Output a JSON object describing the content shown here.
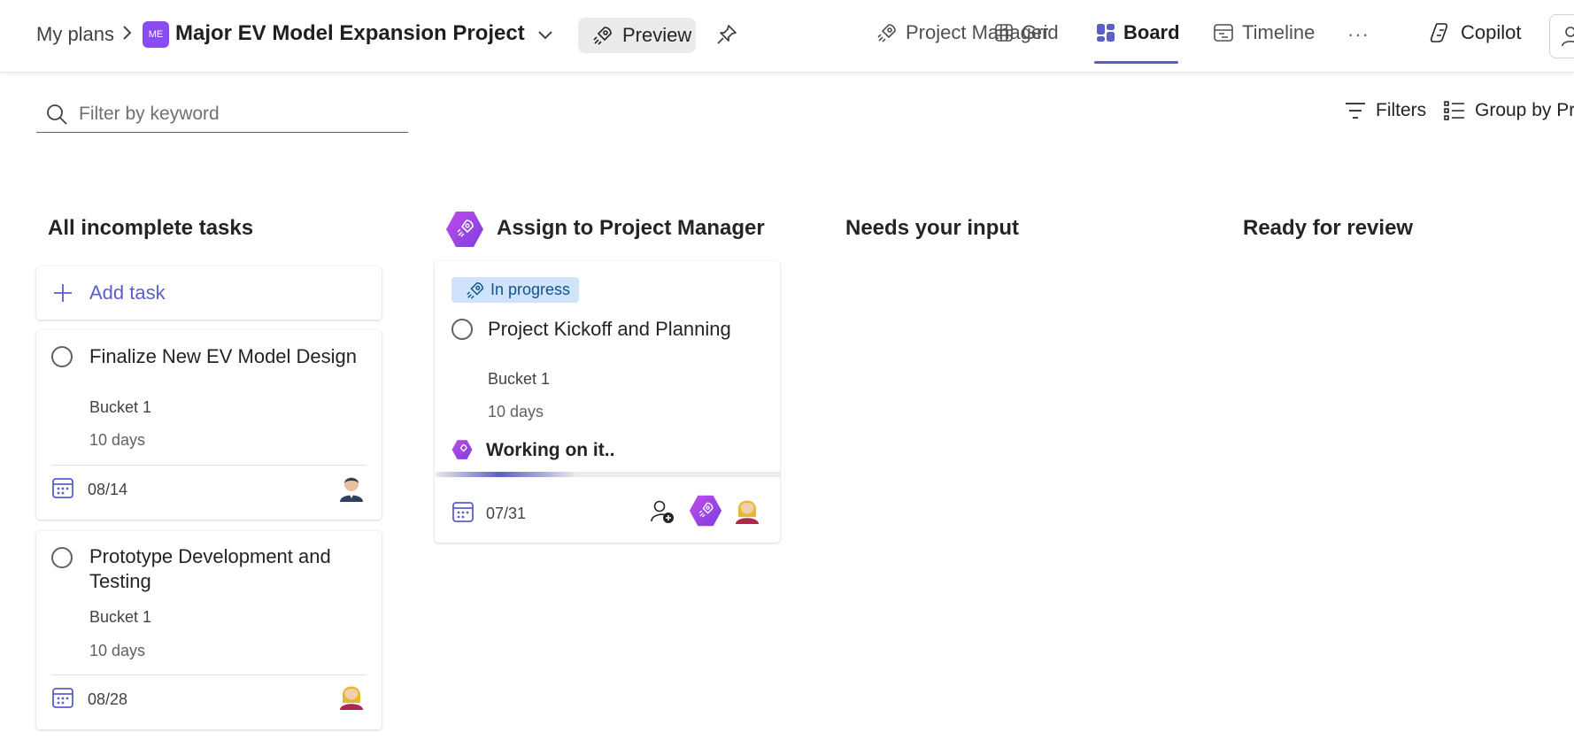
{
  "breadcrumb": {
    "root": "My plans"
  },
  "plan": {
    "badge": "ME",
    "title": "Major EV Model Expansion Project"
  },
  "preview": {
    "label": "Preview"
  },
  "tabs": [
    {
      "label": "Project Manager",
      "icon": "rocket-icon"
    },
    {
      "label": "Grid",
      "icon": "grid-icon"
    },
    {
      "label": "Board",
      "icon": "board-icon",
      "active": true
    },
    {
      "label": "Timeline",
      "icon": "timeline-icon"
    }
  ],
  "more": {
    "label": "···"
  },
  "copilot": {
    "label": "Copilot"
  },
  "filter": {
    "placeholder": "Filter by keyword"
  },
  "toolbar": {
    "filters_label": "Filters",
    "group_by_label": "Group by Pr"
  },
  "columns": [
    {
      "title": "All incomplete tasks"
    },
    {
      "title": "Assign to Project Manager"
    },
    {
      "title": "Needs your input"
    },
    {
      "title": "Ready for review"
    }
  ],
  "add_task": {
    "label": "Add task"
  },
  "tasks": [
    {
      "title": "Finalize New EV Model Design",
      "bucket": "Bucket 1",
      "duration": "10 days",
      "due": "08/14"
    },
    {
      "title": "Prototype Development and Testing",
      "bucket": "Bucket 1",
      "duration": "10 days",
      "due": "08/28"
    }
  ],
  "agent_task": {
    "status": "In progress",
    "title": "Project Kickoff and Planning",
    "bucket": "Bucket 1",
    "duration": "10 days",
    "working_label": "Working on it..",
    "due": "07/31"
  },
  "colors": {
    "accent": "#5b5fc7",
    "agent": "#a23ff0",
    "badge": "#8a4bf0",
    "status_bg": "#cfe4fa"
  }
}
